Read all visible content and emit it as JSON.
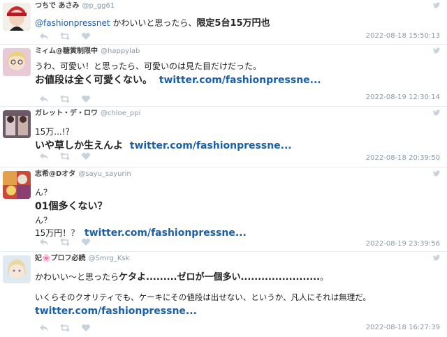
{
  "tweets": [
    {
      "name": "つちで あさみ",
      "handle": "@p_gg61",
      "mention": "@fashionpressnet",
      "text_normal": " かわいいと思ったら、",
      "text_bold": "限定5台15万円也",
      "time": "2022-08-18 15:50:13"
    },
    {
      "name": "ミィム@糖質制限中",
      "handle": "@happylab",
      "line1": "うわ、可愛い！と思ったら、可愛いのは見た目だけだった。",
      "line2_bold": "お値段は全く可愛くない。",
      "link": "twitter.com/fashionpressne...",
      "time": "2022-08-19 12:30:14"
    },
    {
      "name": "ガレット・デ・ロワ",
      "handle": "@chloe_ppi",
      "line1": "15万...!？",
      "line2_bold": "いや草しか生えんよ",
      "link": "twitter.com/fashionpressne...",
      "time": "2022-08-18 20:39:50"
    },
    {
      "name": "志希@Dオタ",
      "handle": "@sayu_sayurin",
      "line1": "ん？",
      "line2_bold": "01個多くない？",
      "line3": "ん？",
      "line4": "15万円！？",
      "link": "twitter.com/fashionpressne...",
      "time": "2022-08-19 23:39:56"
    },
    {
      "name": "妃🌸プロフ必読",
      "handle": "@Smrg_Ksk",
      "line1_normal": "かわいい〜と思ったら",
      "line1_bold": "ケタよ.........ゼロが一個多い.......................",
      "line1_end": "。",
      "line2": "いくらそのクオリティでも、ケーキにその値段は出せない、というか、凡人にそれは無理だ。",
      "link": "twitter.com/fashionpressne...",
      "time": "2022-08-18 16:27:39"
    }
  ],
  "colors": {
    "link": "#1b5fa8",
    "meta": "#8899a6",
    "icon": "#c8d2da"
  },
  "icons": [
    "reply-icon",
    "retweet-icon",
    "like-icon",
    "twitter-bird-icon"
  ]
}
